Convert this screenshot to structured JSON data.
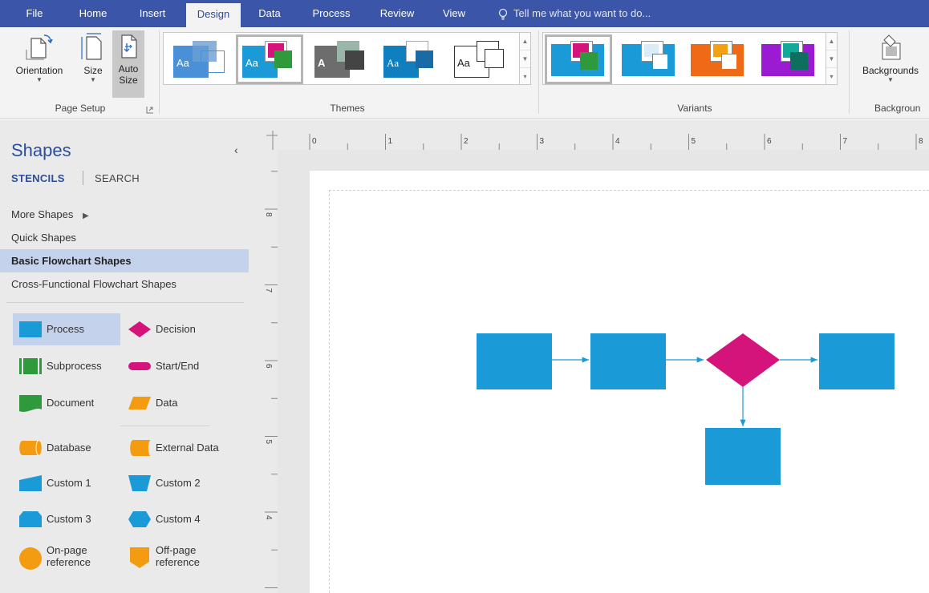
{
  "tabs": [
    "File",
    "Home",
    "Insert",
    "Design",
    "Data",
    "Process",
    "Review",
    "View"
  ],
  "active_tab": "Design",
  "tell_me": "Tell me what you want to do...",
  "ribbon": {
    "page_setup": {
      "label": "Page Setup",
      "orientation": "Orientation",
      "size": "Size",
      "auto_size_1": "Auto",
      "auto_size_2": "Size"
    },
    "themes": {
      "label": "Themes",
      "aa": "Aa",
      "a": "A"
    },
    "variants": {
      "label": "Variants"
    },
    "backgrounds": {
      "label": "Backgroun",
      "button": "Backgrounds"
    }
  },
  "shapes_pane": {
    "title": "Shapes",
    "collapse": "‹",
    "tab_stencils": "STENCILS",
    "tab_search": "SEARCH",
    "stencils": [
      "More Shapes",
      "Quick Shapes",
      "Basic Flowchart Shapes",
      "Cross-Functional Flowchart Shapes"
    ],
    "selected_stencil": "Basic Flowchart Shapes",
    "shapes": [
      {
        "label": "Process",
        "icon": "process-icon"
      },
      {
        "label": "Decision",
        "icon": "decision-icon"
      },
      {
        "label": "Subprocess",
        "icon": "subprocess-icon"
      },
      {
        "label": "Start/End",
        "icon": "start-end-icon"
      },
      {
        "label": "Document",
        "icon": "document-icon"
      },
      {
        "label": "Data",
        "icon": "data-icon"
      },
      {
        "label": "Database",
        "icon": "database-icon"
      },
      {
        "label": "External Data",
        "icon": "external-data-icon"
      },
      {
        "label": "Custom 1",
        "icon": "custom-1-icon"
      },
      {
        "label": "Custom 2",
        "icon": "custom-2-icon"
      },
      {
        "label": "Custom 3",
        "icon": "custom-3-icon"
      },
      {
        "label": "Custom 4",
        "icon": "custom-4-icon"
      },
      {
        "label": "On-page",
        "label2": "reference",
        "icon": "on-page-reference-icon"
      },
      {
        "label": "Off-page",
        "label2": "reference",
        "icon": "off-page-reference-icon"
      }
    ]
  },
  "ruler": {
    "h": [
      "0",
      "1",
      "2",
      "3",
      "4",
      "5",
      "6",
      "7",
      "8"
    ],
    "v": [
      "8",
      "7",
      "6",
      "5",
      "4"
    ]
  },
  "colors": {
    "tabbar": "#3b56a8",
    "accent": "#2b4d9a",
    "process": "#1a9bd7",
    "decision": "#d4147a",
    "subprocess": "#2e9a3c",
    "data_orange": "#f39c12"
  }
}
